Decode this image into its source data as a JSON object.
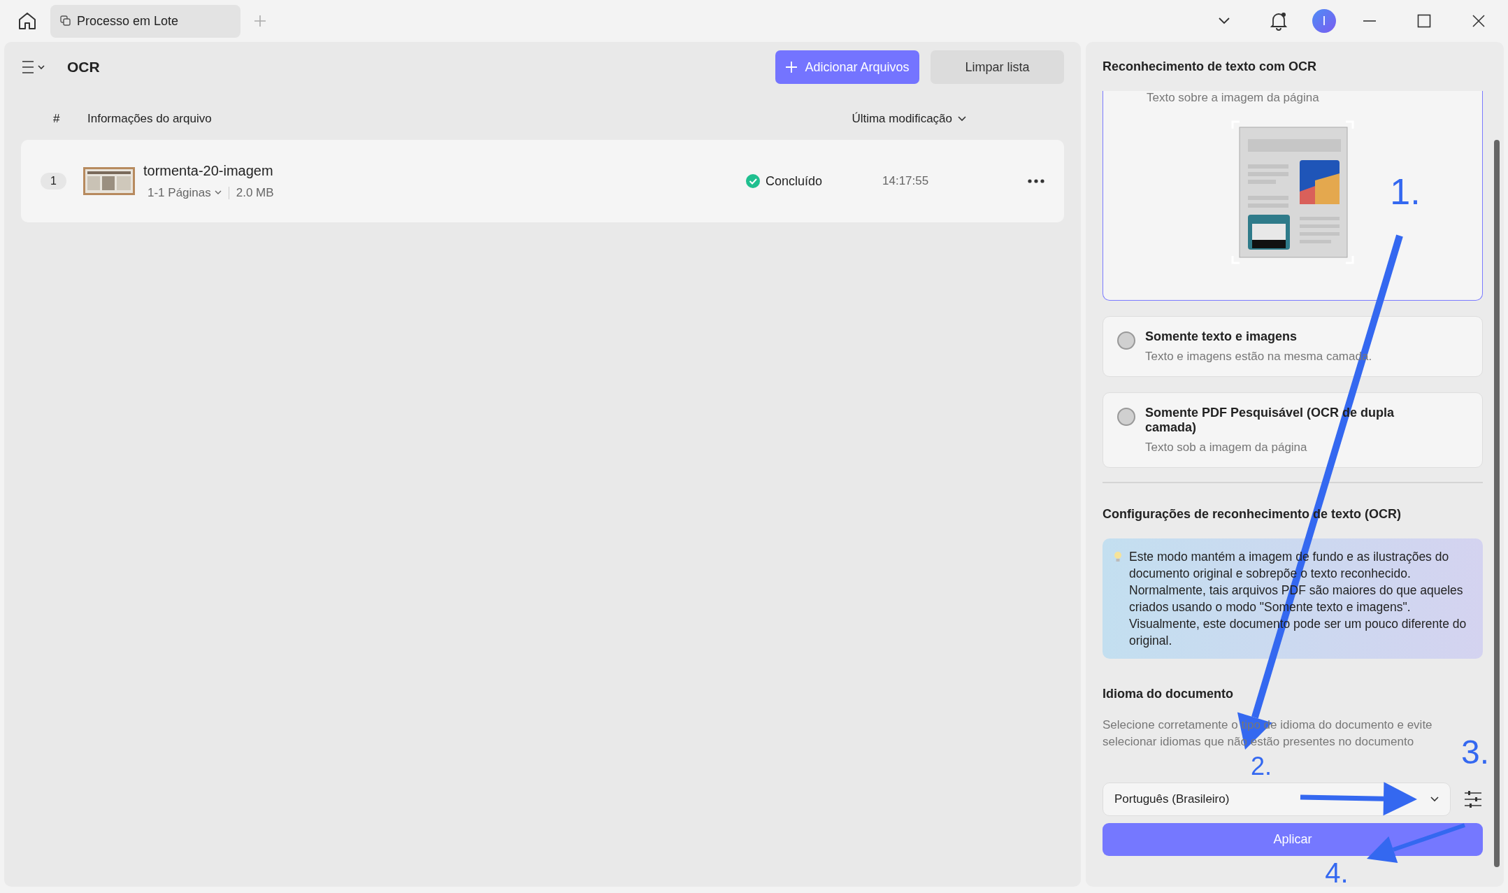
{
  "tab_bar": {
    "tabs": [
      {
        "label": "Processo em Lote",
        "selected": true
      }
    ]
  },
  "avatar": {
    "initial": "I"
  },
  "toolbar": {
    "title": "OCR",
    "buttons": [
      {
        "label": "Adicionar Arquivos",
        "kind": "primary"
      },
      {
        "label": "Limpar lista",
        "kind": "secondary"
      }
    ]
  },
  "file_table": {
    "columns": [
      "#",
      "Informações do arquivo",
      "Última modificação"
    ],
    "rows": [
      {
        "number": "1",
        "name": "tormenta-20-imagem",
        "pages": "1-1 Páginas",
        "size": "2.0 MB",
        "status": "Concluído",
        "time": "14:17:55"
      }
    ]
  },
  "ocr_panel": {
    "title": "Reconhecimento de texto com OCR",
    "options": [
      {
        "description": "Texto sobre a imagem da página",
        "selected": true
      },
      {
        "title": "Somente texto e imagens",
        "description": "Texto e imagens estão na mesma camada.",
        "selected": false
      },
      {
        "title": "Somente PDF Pesquisável (OCR de dupla camada)",
        "description": "Texto sob a imagem da página",
        "selected": false
      }
    ],
    "settings_title": "Configurações de reconhecimento de texto (OCR)",
    "tip": "Este modo mantém a imagem de fundo e as ilustrações do documento original e sobrepõe o texto reconhecido. Normalmente, tais arquivos PDF são maiores do que aqueles criados usando o modo \"Somente texto e imagens\". Visualmente, este documento pode ser um pouco diferente do original.",
    "language": {
      "title": "Idioma do documento",
      "hint": "Selecione corretamente o tipo de idioma do documento e evite selecionar idiomas que não estão presentes no documento",
      "value": "Português (Brasileiro)"
    },
    "apply": "Aplicar"
  },
  "annotations": [
    {
      "label": "1."
    },
    {
      "label": "2."
    },
    {
      "label": "3."
    },
    {
      "label": "4."
    }
  ]
}
